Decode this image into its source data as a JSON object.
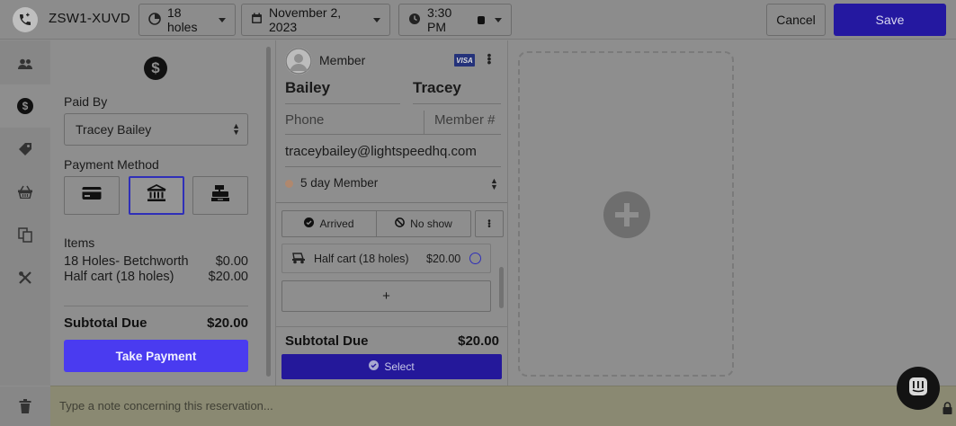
{
  "topbar": {
    "reservation_id": "ZSW1-XUVD",
    "holes": "18 holes",
    "date": "November 2, 2023",
    "time": "3:30 PM",
    "cancel_label": "Cancel",
    "save_label": "Save"
  },
  "rail": {
    "items": [
      "users-icon",
      "dollar-icon",
      "tag-icon",
      "basket-icon",
      "copy-icon",
      "tools-icon"
    ],
    "active": "dollar-icon",
    "bottom": "trash-icon"
  },
  "payment": {
    "paid_by_label": "Paid By",
    "paid_by_value": "Tracey Bailey",
    "method_label": "Payment Method",
    "methods": [
      "credit-card-icon",
      "bank-icon",
      "cash-register-icon"
    ],
    "selected_method": "bank-icon",
    "items_label": "Items",
    "items": [
      {
        "name": "18 Holes- Betchworth",
        "price": "$0.00"
      },
      {
        "name": "Half cart (18 holes)",
        "price": "$20.00"
      }
    ],
    "subtotal_label": "Subtotal Due",
    "subtotal_value": "$20.00",
    "take_payment_label": "Take Payment"
  },
  "member": {
    "type_label": "Member",
    "card_brand": "VISA",
    "first_name": "Bailey",
    "last_name": "Tracey",
    "phone_placeholder": "Phone",
    "member_no_placeholder": "Member #",
    "email": "traceybailey@lightspeedhq.com",
    "membership": "5 day Member",
    "arrived_label": "Arrived",
    "noshow_label": "No show",
    "cart_item": "Half cart (18 holes)",
    "cart_price": "$20.00",
    "add_label": "+",
    "subtotal_label": "Subtotal Due",
    "subtotal_value": "$20.00",
    "select_label": "Select"
  },
  "note": {
    "placeholder": "Type a note concerning this reservation..."
  },
  "colors": {
    "primary": "#2418a0",
    "take_payment": "#4a3bf0",
    "overlay_bg": "#8e8e8e"
  }
}
